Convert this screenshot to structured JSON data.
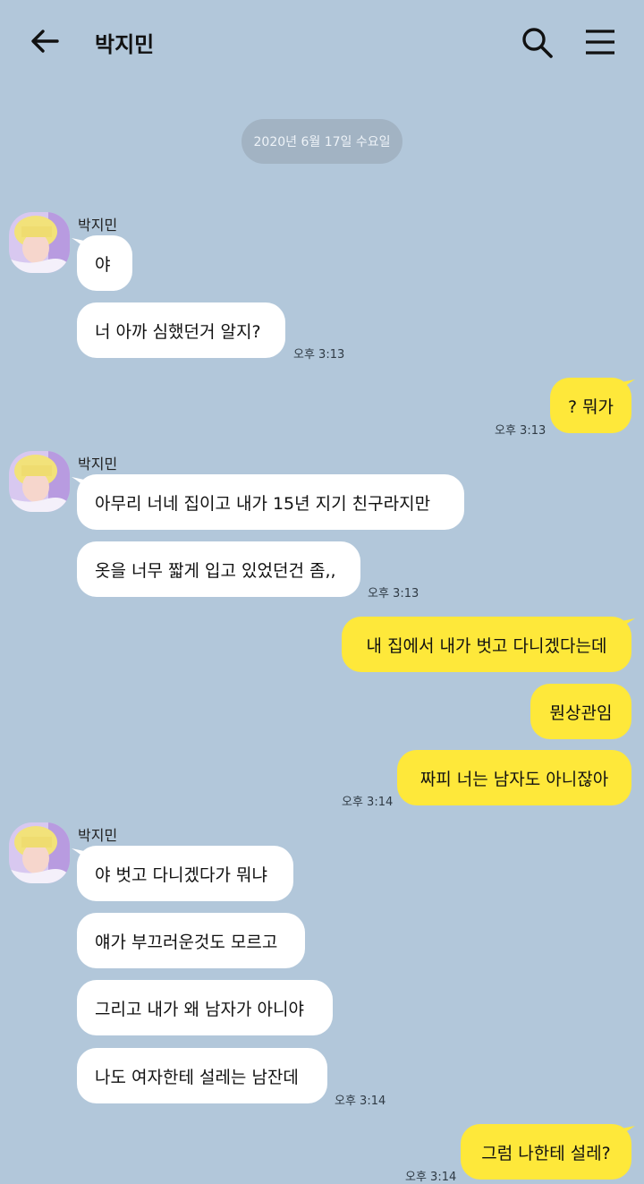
{
  "header": {
    "title": "박지민",
    "back_icon": "arrow-left-icon",
    "search_icon": "search-icon",
    "menu_icon": "hamburger-menu-icon"
  },
  "date_divider": "2020년 6월 17일 수요일",
  "colors": {
    "background": "#b2c7da",
    "incoming_bubble": "#ffffff",
    "outgoing_bubble": "#fee83a",
    "date_pill": "#a2b3c3"
  },
  "messages": [
    {
      "sender": "박지민",
      "text": "야"
    },
    {
      "text": "너 아까 심했던거 알지?",
      "time": "오후 3:13"
    },
    {
      "text": "? 뭐가",
      "time": "오후 3:13"
    },
    {
      "sender": "박지민",
      "text": "아무리 너네 집이고 내가 15년 지기 친구라지만"
    },
    {
      "text": "옷을 너무 짧게 입고 있었던건 좀,,",
      "time": "오후 3:13"
    },
    {
      "text": "내 집에서 내가 벗고 다니겠다는데"
    },
    {
      "text": "뭔상관임"
    },
    {
      "text": "짜피 너는 남자도 아니잖아",
      "time": "오후 3:14"
    },
    {
      "sender": "박지민",
      "text": "야 벗고 다니겠다가 뭐냐"
    },
    {
      "text": "얘가 부끄러운것도 모르고"
    },
    {
      "text": "그리고 내가 왜 남자가 아니야"
    },
    {
      "text": "나도 여자한테 설레는 남잔데",
      "time": "오후 3:14"
    },
    {
      "text": "그럼 나한테 설레?",
      "time": "오후 3:14"
    }
  ]
}
